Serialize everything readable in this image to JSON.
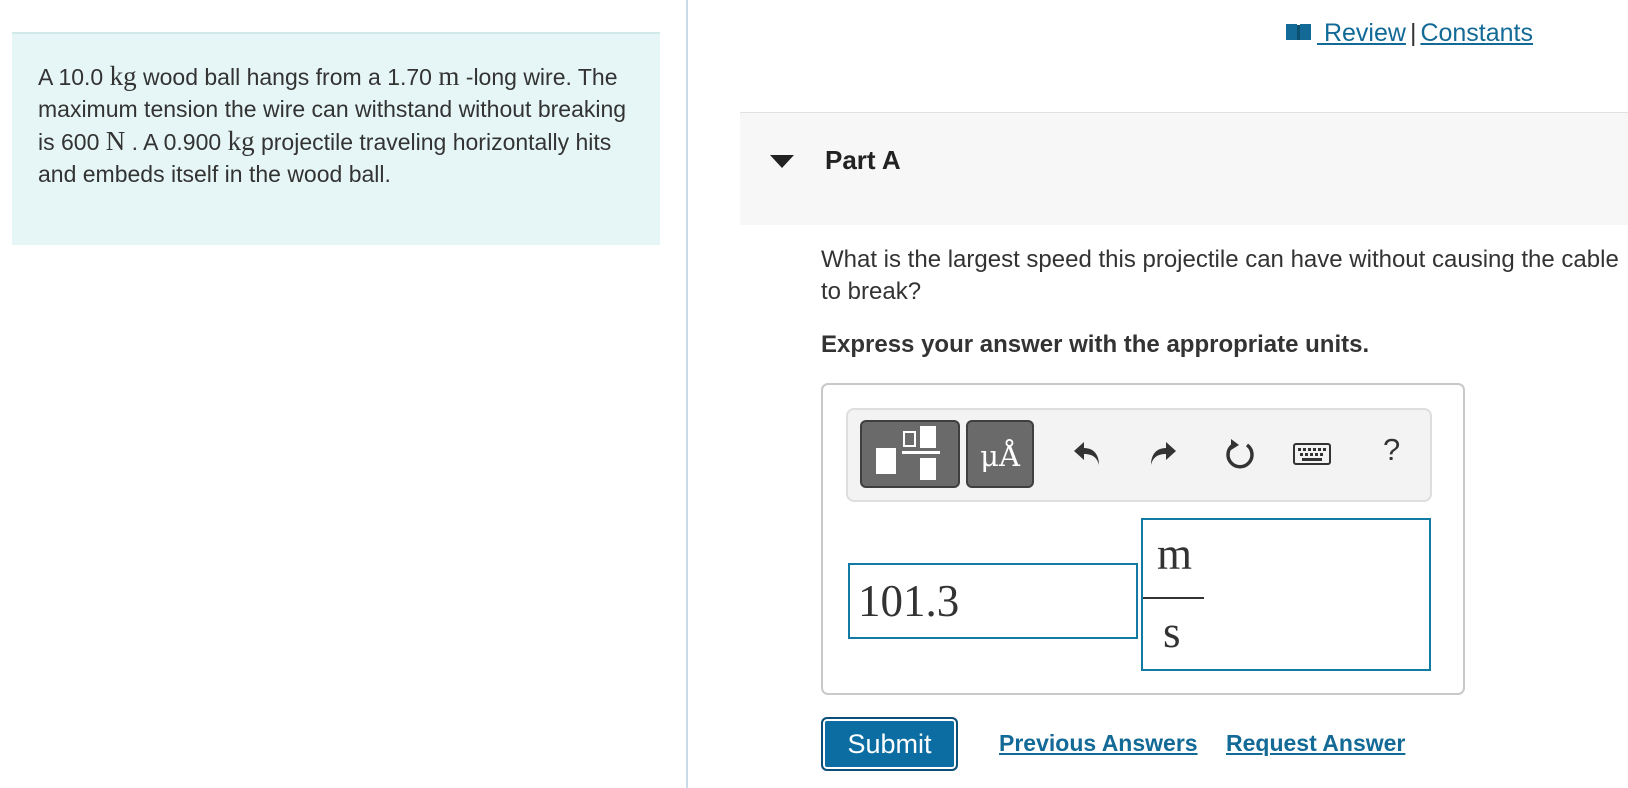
{
  "problem": {
    "t1": "A 10.0 ",
    "u1": "kg",
    "t2": " wood ball hangs from a 1.70 ",
    "u2": "m",
    "t3": " -long wire. The maximum tension the wire can withstand without breaking is 600 ",
    "u3": "N",
    "t4": " . A 0.900 ",
    "u4": "kg",
    "t5": " projectile traveling horizontally hits and embeds itself in the wood ball."
  },
  "header": {
    "review_label": " Review",
    "separator": "|",
    "constants_label": "Constants",
    "book_icon": "book-icon"
  },
  "part": {
    "title": "Part A",
    "question": "What is the largest speed this projectile can have without causing the cable to break?",
    "instruction": "Express your answer with the appropriate units."
  },
  "toolbar": {
    "units_label": "μÅ",
    "help_label": "?",
    "icons": [
      "templates-icon",
      "units-icon",
      "undo-icon",
      "redo-icon",
      "reset-icon",
      "keyboard-icon",
      "help-icon"
    ]
  },
  "answer": {
    "value": "101.3",
    "unit_numerator": "m",
    "unit_denominator": "s"
  },
  "actions": {
    "submit_label": "Submit",
    "previous_answers_label": "Previous Answers",
    "request_answer_label": "Request Answer"
  },
  "colors": {
    "accent": "#0b6da2",
    "link": "#136a96",
    "problem_bg": "#e6f6f6",
    "input_border": "#127aa3"
  }
}
